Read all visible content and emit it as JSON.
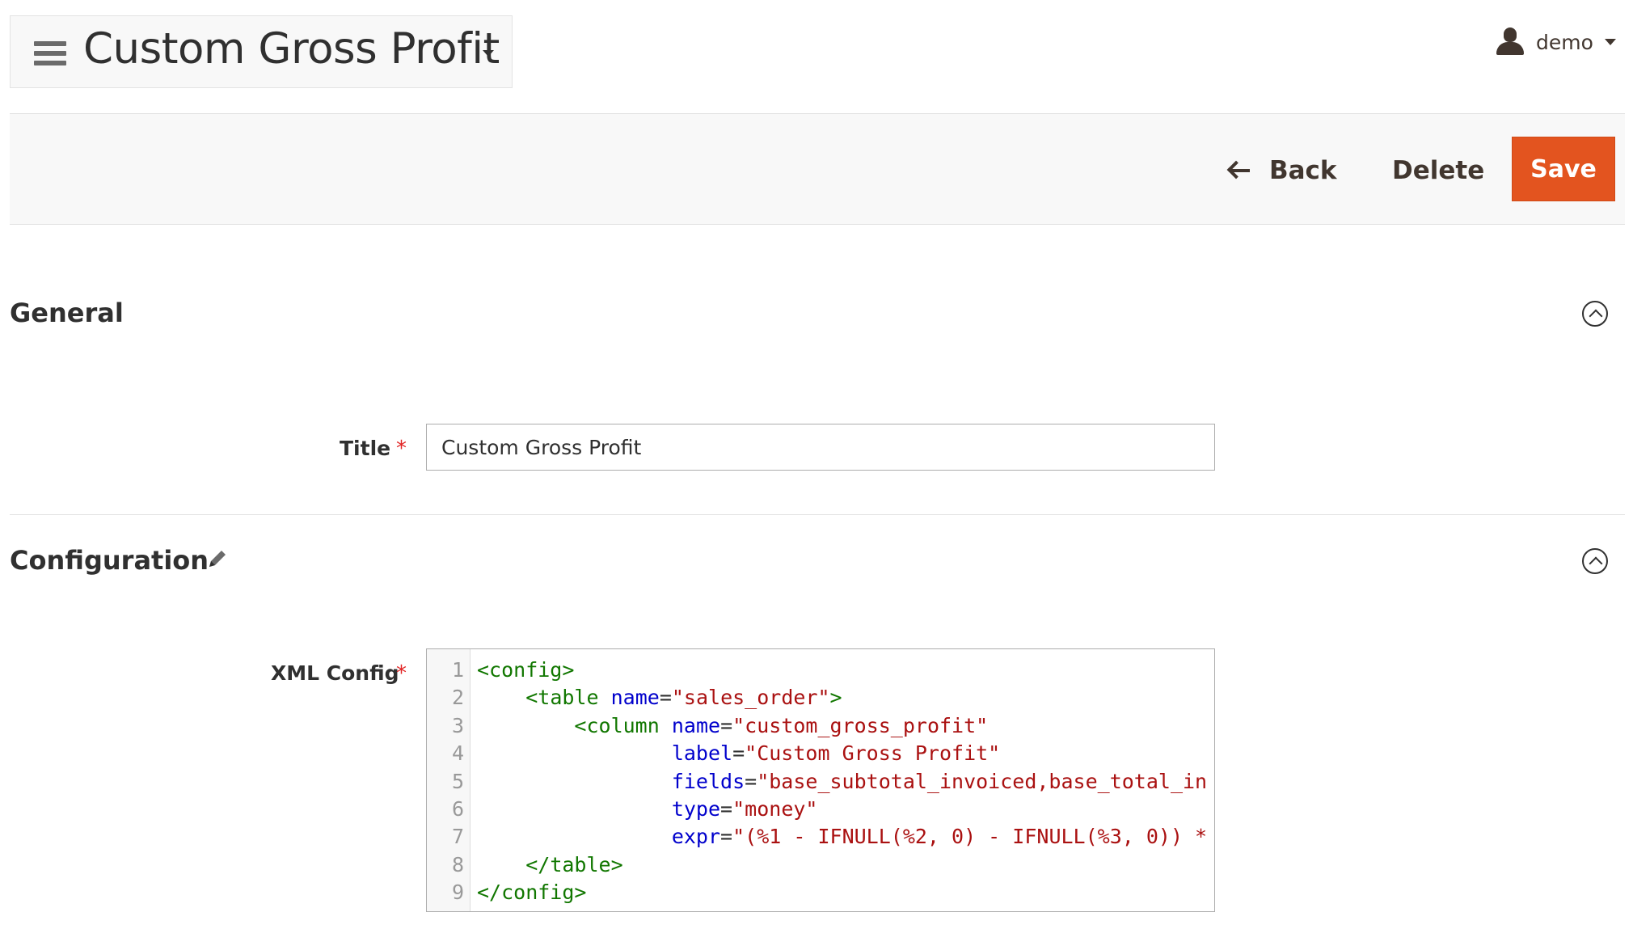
{
  "header": {
    "page_title": "Custom Gross Profit",
    "user_name": "demo"
  },
  "actions": {
    "back_label": "Back",
    "delete_label": "Delete",
    "save_label": "Save",
    "save_color": "#e3541f"
  },
  "sections": {
    "general": {
      "title": "General",
      "fields": {
        "title_label": "Title",
        "title_value": "Custom Gross Profit",
        "required_mark": "*"
      }
    },
    "configuration": {
      "title": "Configuration",
      "fields": {
        "xml_label": "XML Config",
        "required_mark": "*"
      }
    }
  },
  "code_editor": {
    "line_numbers": [
      "1",
      "2",
      "3",
      "4",
      "5",
      "6",
      "7",
      "8",
      "9"
    ],
    "lines": [
      [
        {
          "t": "tag",
          "v": "<config>"
        }
      ],
      [
        {
          "t": "plain",
          "v": "    "
        },
        {
          "t": "tag",
          "v": "<table"
        },
        {
          "t": "plain",
          "v": " "
        },
        {
          "t": "attr",
          "v": "name"
        },
        {
          "t": "plain",
          "v": "="
        },
        {
          "t": "str",
          "v": "\"sales_order\""
        },
        {
          "t": "tag",
          "v": ">"
        }
      ],
      [
        {
          "t": "plain",
          "v": "        "
        },
        {
          "t": "tag",
          "v": "<column"
        },
        {
          "t": "plain",
          "v": " "
        },
        {
          "t": "attr",
          "v": "name"
        },
        {
          "t": "plain",
          "v": "="
        },
        {
          "t": "str",
          "v": "\"custom_gross_profit\""
        }
      ],
      [
        {
          "t": "plain",
          "v": "                "
        },
        {
          "t": "attr",
          "v": "label"
        },
        {
          "t": "plain",
          "v": "="
        },
        {
          "t": "str",
          "v": "\"Custom Gross Profit\""
        }
      ],
      [
        {
          "t": "plain",
          "v": "                "
        },
        {
          "t": "attr",
          "v": "fields"
        },
        {
          "t": "plain",
          "v": "="
        },
        {
          "t": "str",
          "v": "\"base_subtotal_invoiced,base_total_in"
        }
      ],
      [
        {
          "t": "plain",
          "v": "                "
        },
        {
          "t": "attr",
          "v": "type"
        },
        {
          "t": "plain",
          "v": "="
        },
        {
          "t": "str",
          "v": "\"money\""
        }
      ],
      [
        {
          "t": "plain",
          "v": "                "
        },
        {
          "t": "attr",
          "v": "expr"
        },
        {
          "t": "plain",
          "v": "="
        },
        {
          "t": "str",
          "v": "\"(%1 - IFNULL(%2, 0) - IFNULL(%3, 0)) *"
        }
      ],
      [
        {
          "t": "plain",
          "v": "    "
        },
        {
          "t": "tag",
          "v": "</table>"
        }
      ],
      [
        {
          "t": "tag",
          "v": "</config>"
        }
      ]
    ]
  },
  "colors": {
    "tag": "#117700",
    "attr": "#0000cc",
    "string": "#aa1111",
    "required": "#e22626"
  }
}
